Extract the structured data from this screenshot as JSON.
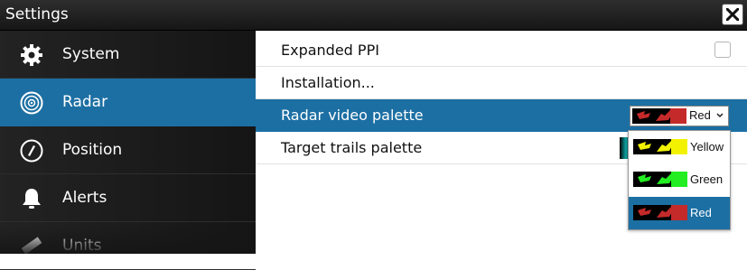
{
  "window": {
    "title": "Settings"
  },
  "sidebar": {
    "items": [
      {
        "label": "System",
        "icon": "gear-icon"
      },
      {
        "label": "Radar",
        "icon": "radar-icon",
        "active": true
      },
      {
        "label": "Position",
        "icon": "compass-icon"
      },
      {
        "label": "Alerts",
        "icon": "bell-icon"
      },
      {
        "label": "Units",
        "icon": "ruler-icon"
      }
    ]
  },
  "content": {
    "rows": [
      {
        "label": "Expanded PPI",
        "control": "checkbox",
        "checked": false
      },
      {
        "label": "Installation..."
      },
      {
        "label": "Radar video palette",
        "value": "Red",
        "selected": true
      },
      {
        "label": "Target trails palette"
      }
    ]
  },
  "palette_dropdown": {
    "value": "Red",
    "options": [
      {
        "label": "Yellow",
        "color": "#f2f200"
      },
      {
        "label": "Green",
        "color": "#22ee22"
      },
      {
        "label": "Red",
        "color": "#c42a2a",
        "selected": true
      }
    ]
  },
  "colors": {
    "accent": "#1c6fa3",
    "titlebar": "#222222",
    "sidebar": "#1b1b1b"
  }
}
